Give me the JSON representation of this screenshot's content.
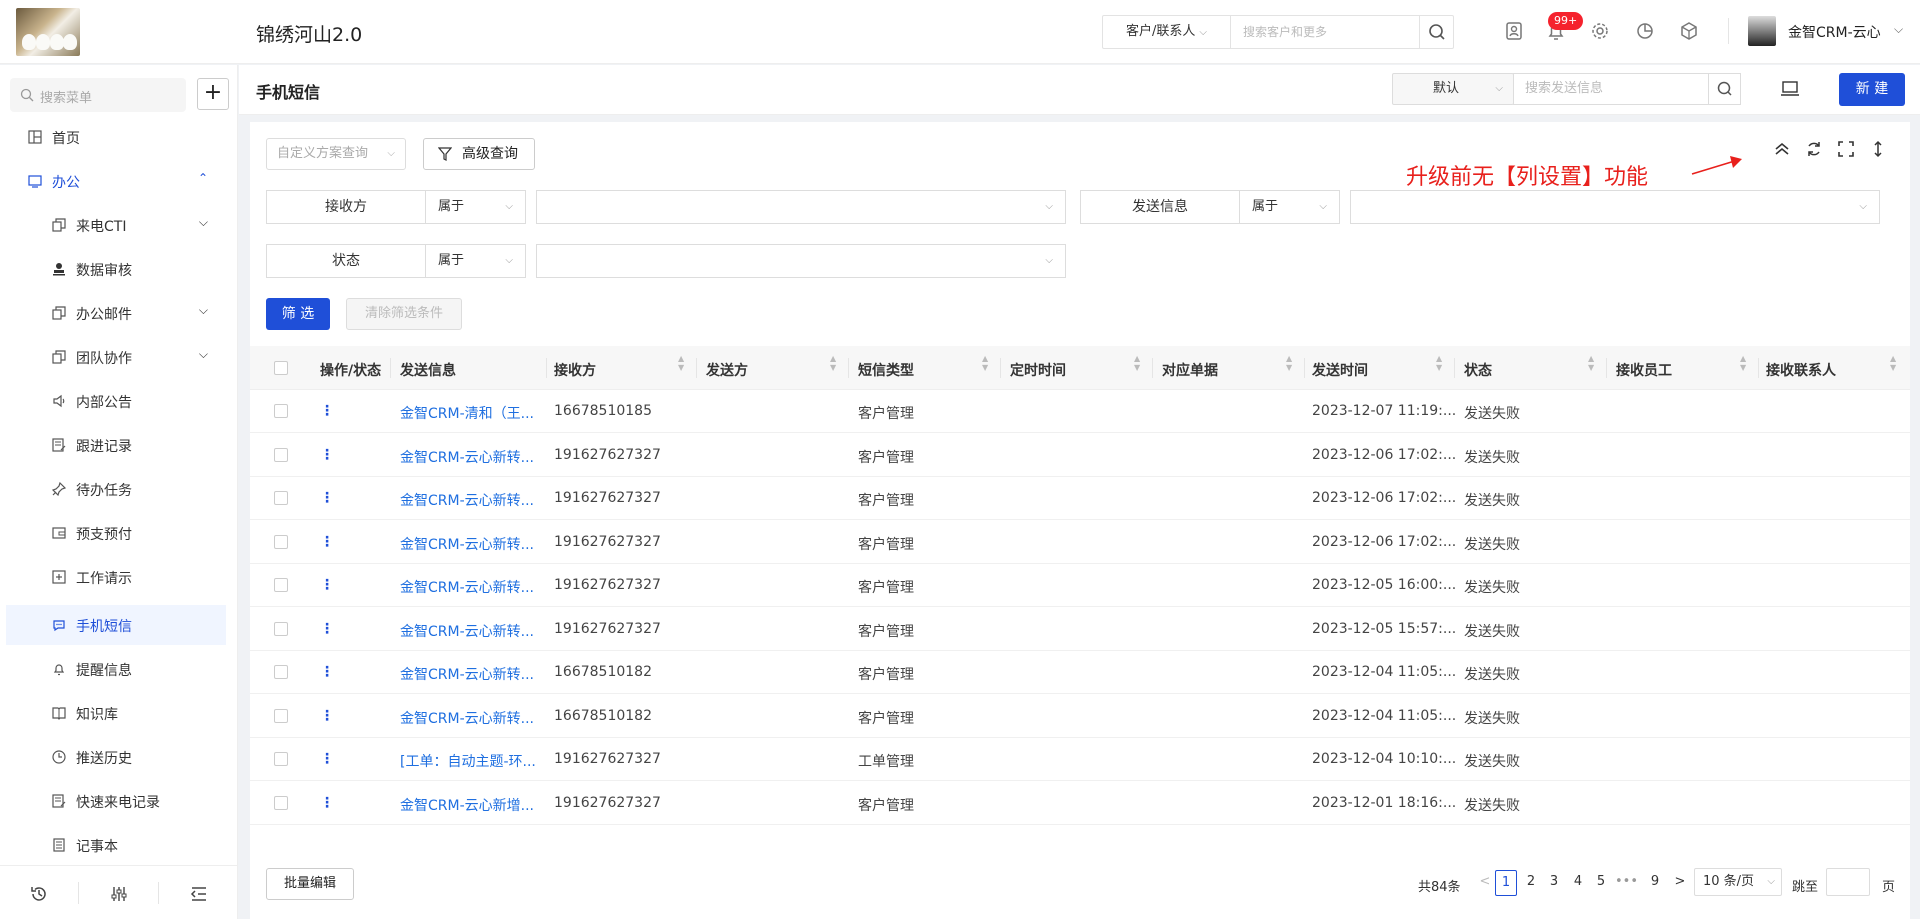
{
  "app": {
    "title": "锦绣河山2.0"
  },
  "topbar": {
    "search_scope": "客户/联系人",
    "search_placeholder": "搜索客户和更多",
    "notification_count": "99+",
    "user_name": "金智CRM-云心"
  },
  "sidebar": {
    "search_placeholder": "搜索菜单",
    "items": [
      {
        "label": "首页",
        "icon": "home-icon"
      },
      {
        "label": "办公",
        "icon": "office-icon"
      },
      {
        "label": "来电CTI",
        "icon": "copy-icon"
      },
      {
        "label": "数据审核",
        "icon": "stamp-icon"
      },
      {
        "label": "办公邮件",
        "icon": "copy-icon"
      },
      {
        "label": "团队协作",
        "icon": "copy-icon"
      },
      {
        "label": "内部公告",
        "icon": "speaker-icon"
      },
      {
        "label": "跟进记录",
        "icon": "edit-doc-icon"
      },
      {
        "label": "待办任务",
        "icon": "pin-icon"
      },
      {
        "label": "预支预付",
        "icon": "wallet-icon"
      },
      {
        "label": "工作请示",
        "icon": "plus-doc-icon"
      },
      {
        "label": "手机短信",
        "icon": "message-icon"
      },
      {
        "label": "提醒信息",
        "icon": "bell-icon"
      },
      {
        "label": "知识库",
        "icon": "book-icon"
      },
      {
        "label": "推送历史",
        "icon": "clock-icon"
      },
      {
        "label": "快速来电记录",
        "icon": "edit-doc-icon"
      },
      {
        "label": "记事本",
        "icon": "notebook-icon"
      }
    ]
  },
  "header": {
    "page_title": "手机短信",
    "view_select": "默认",
    "search_placeholder": "搜索发送信息",
    "new_button": "新 建"
  },
  "filters": {
    "plan_placeholder": "自定义方案查询",
    "advanced_label": "高级查询",
    "annotation": "升级前无【列设置】功能",
    "rows": [
      {
        "label": "接收方",
        "op": "属于"
      },
      {
        "label": "发送信息",
        "op": "属于"
      },
      {
        "label": "状态",
        "op": "属于"
      }
    ],
    "filter_button": "筛 选",
    "clear_button": "清除筛选条件"
  },
  "table": {
    "columns": [
      "操作/状态",
      "发送信息",
      "接收方",
      "发送方",
      "短信类型",
      "定时时间",
      "对应单据",
      "发送时间",
      "状态",
      "接收员工",
      "接收联系人"
    ],
    "rows": [
      {
        "info": "金智CRM-清和（王...",
        "receiver": "16678510185",
        "type": "客户管理",
        "time": "2023-12-07 11:19:...",
        "status": "发送失败"
      },
      {
        "info": "金智CRM-云心新转...",
        "receiver": "191627627327",
        "type": "客户管理",
        "time": "2023-12-06 17:02:...",
        "status": "发送失败"
      },
      {
        "info": "金智CRM-云心新转...",
        "receiver": "191627627327",
        "type": "客户管理",
        "time": "2023-12-06 17:02:...",
        "status": "发送失败"
      },
      {
        "info": "金智CRM-云心新转...",
        "receiver": "191627627327",
        "type": "客户管理",
        "time": "2023-12-06 17:02:...",
        "status": "发送失败"
      },
      {
        "info": "金智CRM-云心新转...",
        "receiver": "191627627327",
        "type": "客户管理",
        "time": "2023-12-05 16:00:...",
        "status": "发送失败"
      },
      {
        "info": "金智CRM-云心新转...",
        "receiver": "191627627327",
        "type": "客户管理",
        "time": "2023-12-05 15:57:...",
        "status": "发送失败"
      },
      {
        "info": "金智CRM-云心新转...",
        "receiver": "16678510182",
        "type": "客户管理",
        "time": "2023-12-04 11:05:...",
        "status": "发送失败"
      },
      {
        "info": "金智CRM-云心新转...",
        "receiver": "16678510182",
        "type": "客户管理",
        "time": "2023-12-04 11:05:...",
        "status": "发送失败"
      },
      {
        "info": "[工单：自动主题-环...",
        "receiver": "191627627327",
        "type": "工单管理",
        "time": "2023-12-04 10:10:...",
        "status": "发送失败"
      },
      {
        "info": "金智CRM-云心新增...",
        "receiver": "191627627327",
        "type": "客户管理",
        "time": "2023-12-01 18:16:...",
        "status": "发送失败"
      }
    ]
  },
  "footer": {
    "batch_edit": "批量编辑",
    "total": "共84条",
    "pages": [
      "1",
      "2",
      "3",
      "4",
      "5",
      "•••",
      "9"
    ],
    "page_size": "10 条/页",
    "jump_label": "跳至",
    "page_unit": "页"
  },
  "colors": {
    "primary": "#1f4fd8",
    "link": "#1f6fe0",
    "annotation": "#e8201c",
    "badge": "#f5222d"
  }
}
